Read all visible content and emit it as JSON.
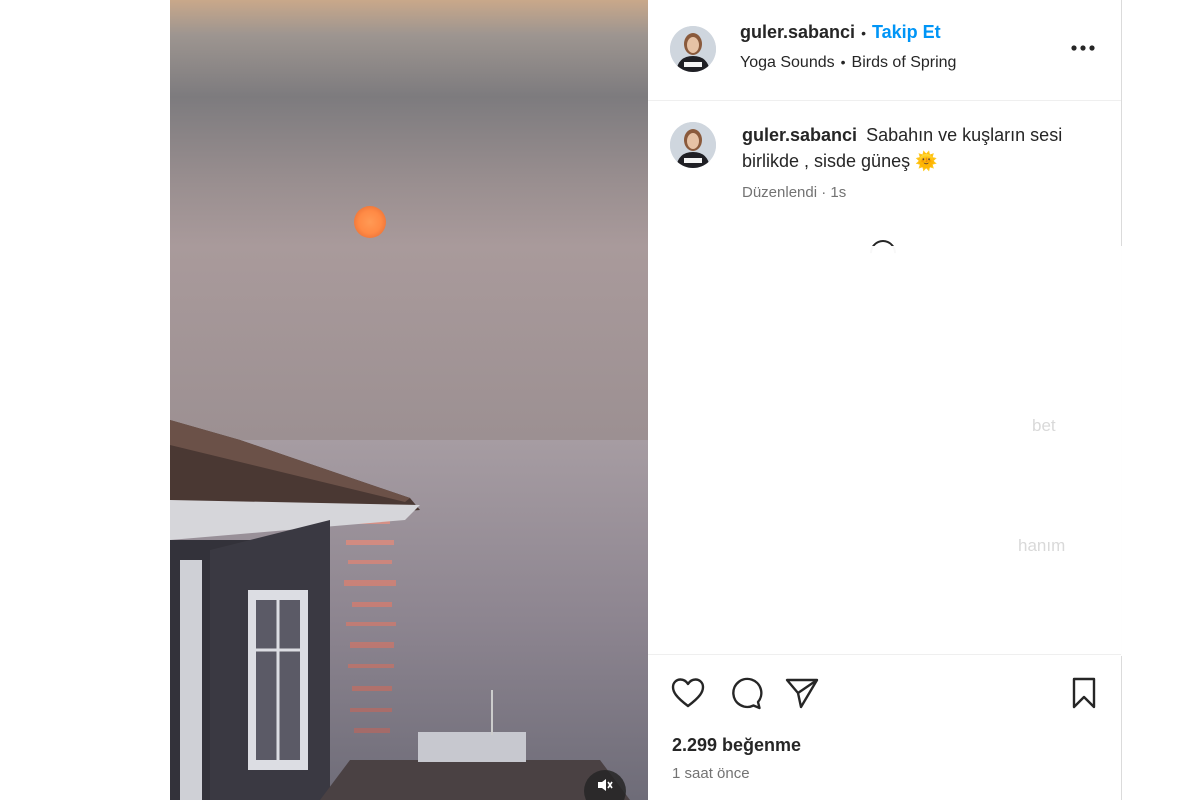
{
  "post": {
    "username": "guler.sabanci",
    "follow_label": "Takip Et",
    "audio": {
      "artist": "Yoga Sounds",
      "track": "Birds of Spring"
    },
    "caption": "Sabahın ve kuşların sesi birlikde , sisde güneş 🌞",
    "edited_label": "Düzenlendi",
    "edited_time": "1s",
    "likes": "2.299 beğenme",
    "posted_time": "1 saat önce"
  },
  "faded_comments": [
    "bet",
    "hanım"
  ],
  "icons": {
    "more": "more-horizontal-icon",
    "like": "heart-icon",
    "comment": "comment-bubble-icon",
    "share": "paper-plane-icon",
    "save": "bookmark-icon",
    "mute": "speaker-muted-icon",
    "loading": "loading-spinner-icon"
  },
  "colors": {
    "accent": "#0095f6",
    "text": "#262626",
    "secondary": "#737373",
    "border": "#dbdbdb"
  }
}
